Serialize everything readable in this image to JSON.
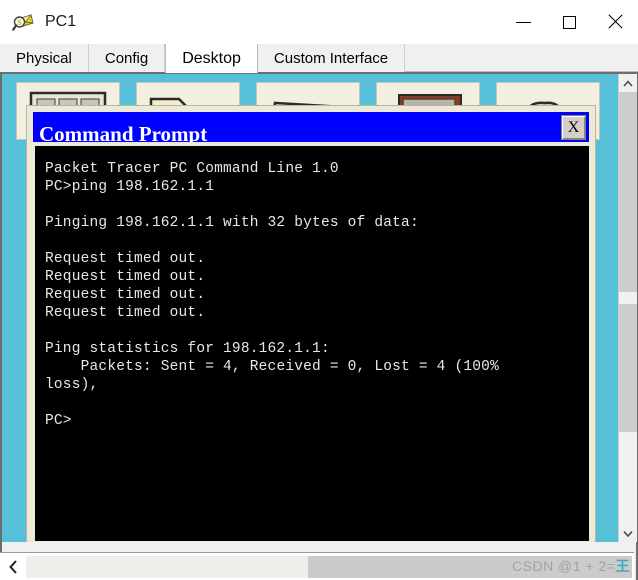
{
  "window": {
    "title": "PC1",
    "icon": "packet-tracer-pc-icon",
    "controls": {
      "minimize": "minimize-icon",
      "maximize": "maximize-icon",
      "close": "close-icon"
    }
  },
  "tabs": [
    {
      "label": "Physical",
      "active": false
    },
    {
      "label": "Config",
      "active": false
    },
    {
      "label": "Desktop",
      "active": true
    },
    {
      "label": "Custom Interface",
      "active": false
    }
  ],
  "desktop": {
    "background_color": "#55c0d8",
    "icon_tiles": 5
  },
  "command_prompt": {
    "title": "Command Prompt",
    "close_label": "X",
    "titlebar_color": "#0000ff",
    "console_bg": "#000000",
    "console_fg": "#e8e8e8",
    "output": "Packet Tracer PC Command Line 1.0\nPC>ping 198.162.1.1\n\nPinging 198.162.1.1 with 32 bytes of data:\n\nRequest timed out.\nRequest timed out.\nRequest timed out.\nRequest timed out.\n\nPing statistics for 198.162.1.1:\n    Packets: Sent = 4, Received = 0, Lost = 4 (100%\nloss),\n\nPC>"
  },
  "scrollbars": {
    "vertical": {
      "up_arrow": "chevron-up-icon",
      "down_arrow": "chevron-down-icon"
    },
    "horizontal": {
      "left_arrow": "chevron-left-icon"
    }
  },
  "watermark": {
    "prefix": "CSDN @1 + 2=",
    "suffix": "王"
  }
}
